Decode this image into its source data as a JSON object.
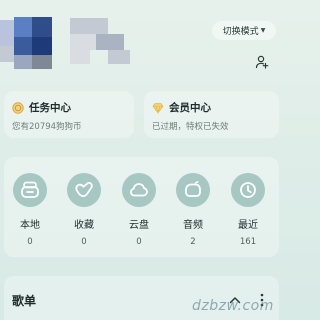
{
  "header": {
    "mode_toggle_label": "切换模式",
    "icons": {
      "mode_caret": "caret-down-icon",
      "add_user": "add-user-icon"
    },
    "avatar_mosaic_colors": [
      "#2f4d8a",
      "#1f3a78",
      "#5a7fc2",
      "#b9c3dd",
      "#9aa7bf",
      "#c4cad3",
      "#7f8896",
      "#3a5b9c",
      "#d9dde2",
      "#a9b3c2"
    ]
  },
  "cards": {
    "task": {
      "title": "任务中心",
      "subtitle": "您有20794狗狗币",
      "icon": "coin-icon",
      "accent": "#d8a83a"
    },
    "vip": {
      "title": "会员中心",
      "subtitle": "已过期，特权已失效",
      "icon": "diamond-icon",
      "accent": "#e3b84a"
    }
  },
  "shortcuts": [
    {
      "label": "本地",
      "count": "0",
      "icon": "local-music-icon"
    },
    {
      "label": "收藏",
      "count": "0",
      "icon": "favorite-icon"
    },
    {
      "label": "云盘",
      "count": "0",
      "icon": "cloud-icon"
    },
    {
      "label": "音频",
      "count": "2",
      "icon": "audio-icon"
    },
    {
      "label": "最近",
      "count": "161",
      "icon": "clock-icon"
    }
  ],
  "playlist": {
    "title": "歌单",
    "icons": {
      "collapse": "chevron-up-icon",
      "more": "more-vertical-icon"
    }
  },
  "watermark": "dzbzw.com",
  "colors": {
    "icon_circle": "#a6c7c2",
    "icon_stroke": "#ffffff",
    "text_primary": "#1f2d2a",
    "text_secondary": "#6d7f7a"
  }
}
